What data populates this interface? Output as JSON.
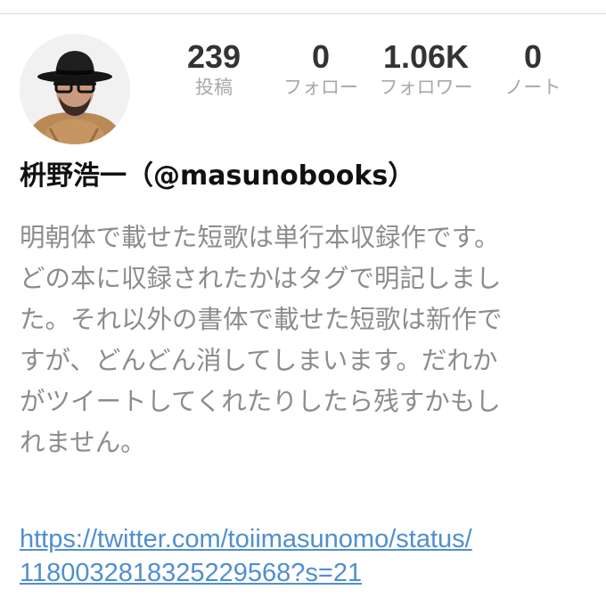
{
  "stats": {
    "posts": {
      "count": "239",
      "label": "投稿"
    },
    "following": {
      "count": "0",
      "label": "フォロー"
    },
    "followers": {
      "count": "1.06K",
      "label": "フォロワー"
    },
    "notes": {
      "count": "0",
      "label": "ノート"
    }
  },
  "profile": {
    "name": "枡野浩一（@masunobooks）",
    "bio_lines": [
      "明朝体で載せた短歌は単行本収録作です。",
      "どの本に収録されたかはタグで明記しまし",
      "た。それ以外の書体で載せた短歌は新作で",
      "すが、どんどん消してしまいます。だれか",
      "がツイートしてくれたりしたら残すかもし",
      "れません。"
    ],
    "link_lines": [
      "https://twitter.com/toiimasunomo/status/",
      "1180032818325229568?s=21"
    ]
  },
  "colors": {
    "count_text": "#333333",
    "label_text": "#a8a8a8",
    "bio_text": "#8c8c8c",
    "link": "#4f8fd0",
    "divider": "#d9d9d9"
  },
  "icons": {
    "avatar": "profile-photo-man-with-black-hat-glasses-scarf"
  }
}
